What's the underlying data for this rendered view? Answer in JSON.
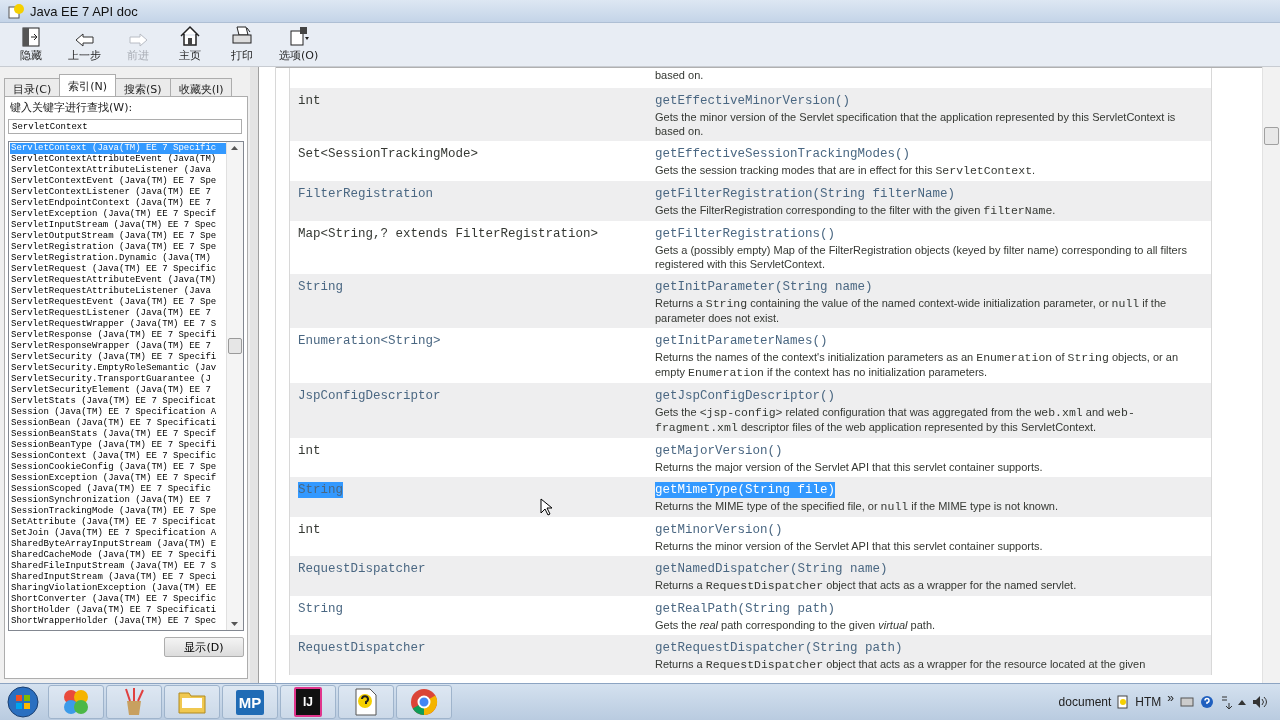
{
  "window": {
    "title": "Java EE 7 API doc"
  },
  "toolbar": [
    {
      "kind": "hide",
      "label": "隐藏",
      "disabled": false
    },
    {
      "kind": "back",
      "label": "上一步",
      "disabled": false
    },
    {
      "kind": "forward",
      "label": "前进",
      "disabled": true
    },
    {
      "kind": "home",
      "label": "主页",
      "disabled": false
    },
    {
      "kind": "print",
      "label": "打印",
      "disabled": false
    },
    {
      "kind": "options",
      "label": "选项(O)",
      "disabled": false
    }
  ],
  "nav_tabs": [
    {
      "label": "目录(C)",
      "selected": false
    },
    {
      "label": "索引(N)",
      "selected": true
    },
    {
      "label": "搜索(S)",
      "selected": false
    },
    {
      "label": "收藏夹(I)",
      "selected": false
    }
  ],
  "index": {
    "prompt": "键入关键字进行查找(W):",
    "search_value": "ServletContext",
    "display_button": "显示(D)",
    "items": [
      {
        "text": "ServletContext (Java(TM) EE 7 Specific",
        "selected": true
      },
      {
        "text": "ServletContextAttributeEvent (Java(TM)",
        "selected": false
      },
      {
        "text": "ServletContextAttributeListener (Java",
        "selected": false
      },
      {
        "text": "ServletContextEvent (Java(TM) EE 7 Spe",
        "selected": false
      },
      {
        "text": "ServletContextListener (Java(TM) EE 7",
        "selected": false
      },
      {
        "text": "ServletEndpointContext (Java(TM) EE 7",
        "selected": false
      },
      {
        "text": "ServletException (Java(TM) EE 7 Specif",
        "selected": false
      },
      {
        "text": "ServletInputStream (Java(TM) EE 7 Spec",
        "selected": false
      },
      {
        "text": "ServletOutputStream (Java(TM) EE 7 Spe",
        "selected": false
      },
      {
        "text": "ServletRegistration (Java(TM) EE 7 Spe",
        "selected": false
      },
      {
        "text": "ServletRegistration.Dynamic (Java(TM)",
        "selected": false
      },
      {
        "text": "ServletRequest (Java(TM) EE 7 Specific",
        "selected": false
      },
      {
        "text": "ServletRequestAttributeEvent (Java(TM)",
        "selected": false
      },
      {
        "text": "ServletRequestAttributeListener (Java",
        "selected": false
      },
      {
        "text": "ServletRequestEvent (Java(TM) EE 7 Spe",
        "selected": false
      },
      {
        "text": "ServletRequestListener (Java(TM) EE 7",
        "selected": false
      },
      {
        "text": "ServletRequestWrapper (Java(TM) EE 7 S",
        "selected": false
      },
      {
        "text": "ServletResponse (Java(TM) EE 7 Specifi",
        "selected": false
      },
      {
        "text": "ServletResponseWrapper (Java(TM) EE 7",
        "selected": false
      },
      {
        "text": "ServletSecurity (Java(TM) EE 7 Specifi",
        "selected": false
      },
      {
        "text": "ServletSecurity.EmptyRoleSemantic (Jav",
        "selected": false
      },
      {
        "text": "ServletSecurity.TransportGuarantee (J",
        "selected": false
      },
      {
        "text": "ServletSecurityElement (Java(TM) EE 7",
        "selected": false
      },
      {
        "text": "ServletStats (Java(TM) EE 7 Specificat",
        "selected": false
      },
      {
        "text": "Session (Java(TM) EE 7 Specification A",
        "selected": false
      },
      {
        "text": "SessionBean (Java(TM) EE 7 Specificati",
        "selected": false
      },
      {
        "text": "SessionBeanStats (Java(TM) EE 7 Specif",
        "selected": false
      },
      {
        "text": "SessionBeanType (Java(TM) EE 7 Specifi",
        "selected": false
      },
      {
        "text": "SessionContext (Java(TM) EE 7 Specific",
        "selected": false
      },
      {
        "text": "SessionCookieConfig (Java(TM) EE 7 Spe",
        "selected": false
      },
      {
        "text": "SessionException (Java(TM) EE 7 Specif",
        "selected": false
      },
      {
        "text": "SessionScoped (Java(TM) EE 7 Specific",
        "selected": false
      },
      {
        "text": "SessionSynchronization (Java(TM) EE 7",
        "selected": false
      },
      {
        "text": "SessionTrackingMode (Java(TM) EE 7 Spe",
        "selected": false
      },
      {
        "text": "SetAttribute (Java(TM) EE 7 Specificat",
        "selected": false
      },
      {
        "text": "SetJoin (Java(TM) EE 7 Specification A",
        "selected": false
      },
      {
        "text": "SharedByteArrayInputStream (Java(TM) E",
        "selected": false
      },
      {
        "text": "SharedCacheMode (Java(TM) EE 7 Specifi",
        "selected": false
      },
      {
        "text": "SharedFileInputStream (Java(TM) EE 7 S",
        "selected": false
      },
      {
        "text": "SharedInputStream (Java(TM) EE 7 Speci",
        "selected": false
      },
      {
        "text": "SharingViolationException (Java(TM) EE",
        "selected": false
      },
      {
        "text": "ShortConverter (Java(TM) EE 7 Specific",
        "selected": false
      },
      {
        "text": "ShortHolder (Java(TM) EE 7 Specificati",
        "selected": false
      },
      {
        "text": "ShortWrapperHolder (Java(TM) EE 7 Spec",
        "selected": false
      }
    ]
  },
  "methods": {
    "rows": [
      {
        "desc": [
          {
            "kind": "text",
            "text": "based on."
          }
        ]
      },
      {
        "type": "int",
        "type_link": false,
        "method": "getEffectiveMinorVersion()",
        "selected": false,
        "desc": [
          {
            "kind": "text",
            "text": "Gets the minor version of the Servlet specification that the application represented by this ServletContext is based on."
          }
        ]
      },
      {
        "type": "Set<SessionTrackingMode>",
        "type_link": false,
        "method": "getEffectiveSessionTrackingModes()",
        "selected": false,
        "desc": [
          {
            "kind": "text",
            "text": "Gets the session tracking modes that are in effect for this "
          },
          {
            "kind": "code",
            "text": "ServletContext"
          },
          {
            "kind": "text",
            "text": "."
          }
        ]
      },
      {
        "type": "FilterRegistration",
        "type_link": true,
        "method": "getFilterRegistration(String filterName)",
        "selected": false,
        "desc": [
          {
            "kind": "text",
            "text": "Gets the FilterRegistration corresponding to the filter with the given "
          },
          {
            "kind": "code",
            "text": "filterName"
          },
          {
            "kind": "text",
            "text": "."
          }
        ]
      },
      {
        "type": "Map<String,? extends FilterRegistration>",
        "type_link": false,
        "method": "getFilterRegistrations()",
        "selected": false,
        "desc": [
          {
            "kind": "text",
            "text": "Gets a (possibly empty) Map of the FilterRegistration objects (keyed by filter name) corresponding to all filters registered with this ServletContext."
          }
        ]
      },
      {
        "type": "String",
        "type_link": true,
        "method": "getInitParameter(String name)",
        "selected": false,
        "desc": [
          {
            "kind": "text",
            "text": "Returns a "
          },
          {
            "kind": "code",
            "text": "String"
          },
          {
            "kind": "text",
            "text": " containing the value of the named context-wide initialization parameter, or "
          },
          {
            "kind": "code",
            "text": "null"
          },
          {
            "kind": "text",
            "text": " if the parameter does not exist."
          }
        ]
      },
      {
        "type": "Enumeration<String>",
        "type_link": true,
        "method": "getInitParameterNames()",
        "selected": false,
        "desc": [
          {
            "kind": "text",
            "text": "Returns the names of the context's initialization parameters as an "
          },
          {
            "kind": "code",
            "text": "Enumeration"
          },
          {
            "kind": "text",
            "text": " of "
          },
          {
            "kind": "code",
            "text": "String"
          },
          {
            "kind": "text",
            "text": " objects, or an empty "
          },
          {
            "kind": "code",
            "text": "Enumeration"
          },
          {
            "kind": "text",
            "text": " if the context has no initialization parameters."
          }
        ]
      },
      {
        "type": "JspConfigDescriptor",
        "type_link": true,
        "method": "getJspConfigDescriptor()",
        "selected": false,
        "desc": [
          {
            "kind": "text",
            "text": "Gets the "
          },
          {
            "kind": "code",
            "text": "<jsp-config>"
          },
          {
            "kind": "text",
            "text": " related configuration that was aggregated from the "
          },
          {
            "kind": "code",
            "text": "web.xml"
          },
          {
            "kind": "text",
            "text": " and "
          },
          {
            "kind": "code",
            "text": "web-fragment.xml"
          },
          {
            "kind": "text",
            "text": " descriptor files of the web application represented by this ServletContext."
          }
        ]
      },
      {
        "type": "int",
        "type_link": false,
        "method": "getMajorVersion()",
        "selected": false,
        "desc": [
          {
            "kind": "text",
            "text": "Returns the major version of the Servlet API that this servlet container supports."
          }
        ]
      },
      {
        "type": "String",
        "type_link": true,
        "method": "getMimeType(String file)",
        "selected": true,
        "desc": [
          {
            "kind": "text",
            "text": "Returns the MIME type of the specified file, or "
          },
          {
            "kind": "code",
            "text": "null"
          },
          {
            "kind": "text",
            "text": " if the MIME type is not known."
          }
        ]
      },
      {
        "type": "int",
        "type_link": false,
        "method": "getMinorVersion()",
        "selected": false,
        "desc": [
          {
            "kind": "text",
            "text": "Returns the minor version of the Servlet API that this servlet container supports."
          }
        ]
      },
      {
        "type": "RequestDispatcher",
        "type_link": true,
        "method": "getNamedDispatcher(String name)",
        "selected": false,
        "desc": [
          {
            "kind": "text",
            "text": "Returns a "
          },
          {
            "kind": "code",
            "text": "RequestDispatcher"
          },
          {
            "kind": "text",
            "text": " object that acts as a wrapper for the named servlet."
          }
        ]
      },
      {
        "type": "String",
        "type_link": true,
        "method": "getRealPath(String path)",
        "selected": false,
        "desc": [
          {
            "kind": "text",
            "text": "Gets the *real* path corresponding to the given *virtual* path."
          }
        ]
      },
      {
        "type": "RequestDispatcher",
        "type_link": true,
        "method": "getRequestDispatcher(String path)",
        "selected": false,
        "desc": [
          {
            "kind": "text",
            "text": "Returns a "
          },
          {
            "kind": "code",
            "text": "RequestDispatcher"
          },
          {
            "kind": "text",
            "text": " object that acts as a wrapper for the resource located at the given"
          }
        ]
      }
    ]
  },
  "taskbar": {
    "apps": [
      {
        "kind": "orb"
      },
      {
        "kind": "circles"
      },
      {
        "kind": "brush"
      },
      {
        "kind": "folder"
      },
      {
        "kind": "tile",
        "label": "MP"
      },
      {
        "kind": "tile-dark",
        "label": "IJ"
      },
      {
        "kind": "help"
      },
      {
        "kind": "browser"
      }
    ],
    "toolbar_label": "document",
    "help_label": "HTM",
    "more": "»"
  }
}
